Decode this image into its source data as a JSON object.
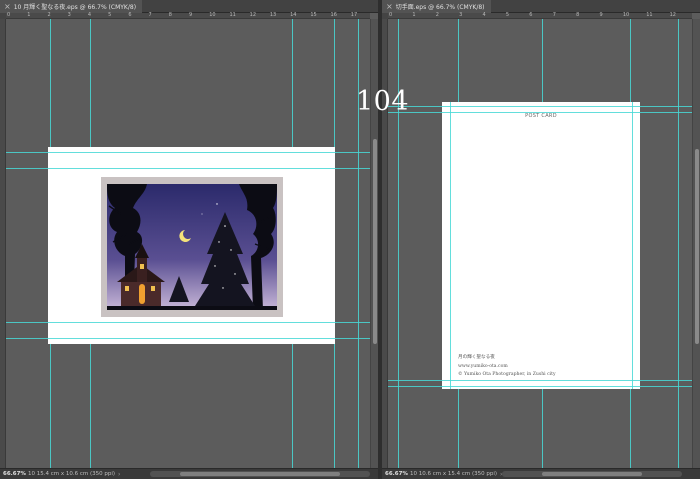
{
  "left_window": {
    "tab_title": "10 月輝く聖なる夜.eps @ 66.7% (CMYK/8)",
    "zoom": "66.67%",
    "doc_info": "10 15.4 cm x 10.6 cm (350 ppi)",
    "ruler_ticks": [
      "0",
      "1",
      "2",
      "3",
      "4",
      "5",
      "6",
      "7",
      "8",
      "9",
      "10",
      "11",
      "12",
      "13",
      "14",
      "15",
      "16",
      "17"
    ]
  },
  "right_window": {
    "tab_title": "切手面.eps @ 66.7% (CMYK/8)",
    "zoom": "66.67%",
    "doc_info": "10 10.6 cm x 15.4 cm (350 ppi)",
    "ruler_ticks": [
      "0",
      "1",
      "2",
      "3",
      "4",
      "5",
      "6",
      "7",
      "8",
      "9",
      "10",
      "11",
      "12"
    ],
    "postcard": {
      "header": "POST CARD",
      "lines": [
        "月の輝く聖なる夜",
        "www.yumiko-ota.com",
        "© Yumiko Ota Photographer, in Zushi city"
      ]
    }
  },
  "page_number": "104",
  "colors": {
    "guide": "#48d8d6",
    "canvas_bg": "#5c5c5c",
    "artboard_frame": "#c9c2c2",
    "night_sky_top": "#2b2a6b",
    "night_sky_bottom": "#c8b7d8"
  },
  "icons": {
    "tab_close": "close-icon",
    "status_arrow": "chevron-right-icon"
  }
}
